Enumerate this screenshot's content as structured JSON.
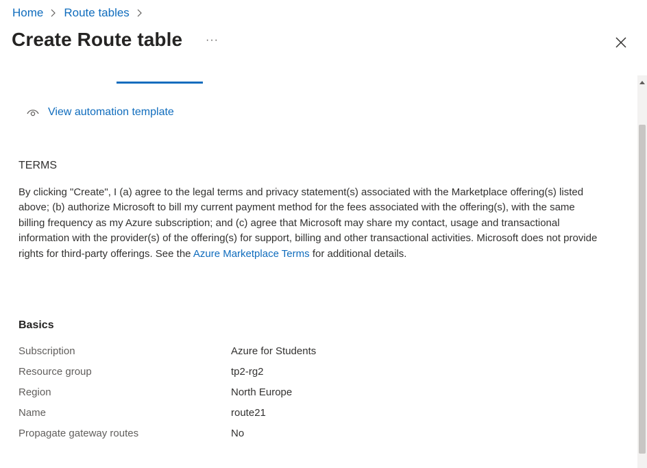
{
  "breadcrumb": {
    "items": [
      "Home",
      "Route tables"
    ]
  },
  "header": {
    "title": "Create Route table",
    "more": "···"
  },
  "automation": {
    "label": "View automation template"
  },
  "terms": {
    "heading": "TERMS",
    "text_before_link": "By clicking \"Create\", I (a) agree to the legal terms and privacy statement(s) associated with the Marketplace offering(s) listed above; (b) authorize Microsoft to bill my current payment method for the fees associated with the offering(s), with the same billing frequency as my Azure subscription; and (c) agree that Microsoft may share my contact, usage and transactional information with the provider(s) of the offering(s) for support, billing and other transactional activities. Microsoft does not provide rights for third-party offerings. See the ",
    "link_text": "Azure Marketplace Terms",
    "text_after_link": " for additional details."
  },
  "basics": {
    "heading": "Basics",
    "rows": [
      {
        "label": "Subscription",
        "value": "Azure for Students"
      },
      {
        "label": "Resource group",
        "value": "tp2-rg2"
      },
      {
        "label": "Region",
        "value": "North Europe"
      },
      {
        "label": "Name",
        "value": "route21"
      },
      {
        "label": "Propagate gateway routes",
        "value": "No"
      }
    ]
  },
  "colors": {
    "link": "#0f6cbd",
    "text": "#323130",
    "muted": "#605e5c",
    "tab_underline": "#0f6cbd"
  },
  "icons": [
    "chevron-right-icon",
    "close-icon",
    "eye-icon",
    "scroll-up-arrow-icon"
  ]
}
